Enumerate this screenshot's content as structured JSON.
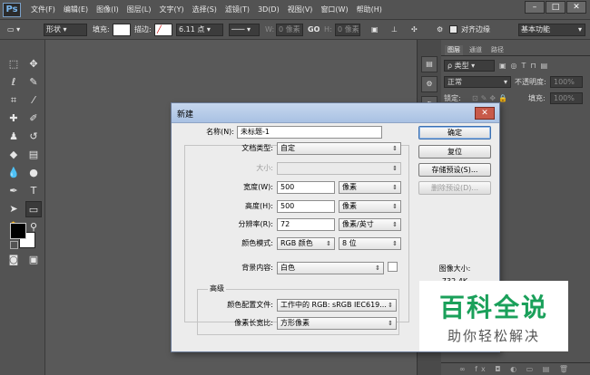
{
  "app": {
    "logo": "Ps"
  },
  "menu": [
    "文件(F)",
    "编辑(E)",
    "图像(I)",
    "图层(L)",
    "文字(Y)",
    "选择(S)",
    "滤镜(T)",
    "3D(D)",
    "视图(V)",
    "窗口(W)",
    "帮助(H)"
  ],
  "window_buttons": [
    "–",
    "□",
    "✕"
  ],
  "options_bar": {
    "style_label": "形状",
    "fill_label": "填充:",
    "stroke_label": "描边:",
    "stroke_size": "6.11 点",
    "w_label": "W:",
    "w_value": "0 像素",
    "link_icon": "GO",
    "h_label": "H:",
    "h_value": "0 像素",
    "align_edges_label": "对齐边缘",
    "workspace": "基本功能"
  },
  "layers_panel": {
    "tabs": [
      "图层",
      "通道",
      "路径"
    ],
    "filter_label": "ρ 类型",
    "blend_mode": "正常",
    "opacity_label": "不透明度:",
    "opacity_value": "100%",
    "lock_label": "锁定:",
    "fill_label": "填充:",
    "fill_value": "100%"
  },
  "dialog": {
    "title": "新建",
    "name_label": "名称(N):",
    "name_value": "未标题-1",
    "doc_type_label": "文档类型:",
    "doc_type_value": "自定",
    "size_label": "大小:",
    "width_label": "宽度(W):",
    "width_value": "500",
    "width_unit": "像素",
    "height_label": "高度(H):",
    "height_value": "500",
    "height_unit": "像素",
    "resolution_label": "分辨率(R):",
    "resolution_value": "72",
    "resolution_unit": "像素/英寸",
    "color_mode_label": "颜色模式:",
    "color_mode_value": "RGB 颜色",
    "bit_depth_value": "8 位",
    "background_label": "背景内容:",
    "background_value": "白色",
    "advanced_label": "高级",
    "color_profile_label": "颜色配置文件:",
    "color_profile_value": "工作中的 RGB: sRGB IEC619...",
    "pixel_aspect_label": "像素长宽比:",
    "pixel_aspect_value": "方形像素",
    "ok_button": "确定",
    "reset_button": "复位",
    "save_preset_button": "存储预设(S)...",
    "delete_preset_button": "删除预设(D)...",
    "image_size_label": "图像大小:",
    "image_size_value": "732.4K"
  },
  "watermark": {
    "title": "百科全说",
    "subtitle": "助你轻松解决"
  }
}
